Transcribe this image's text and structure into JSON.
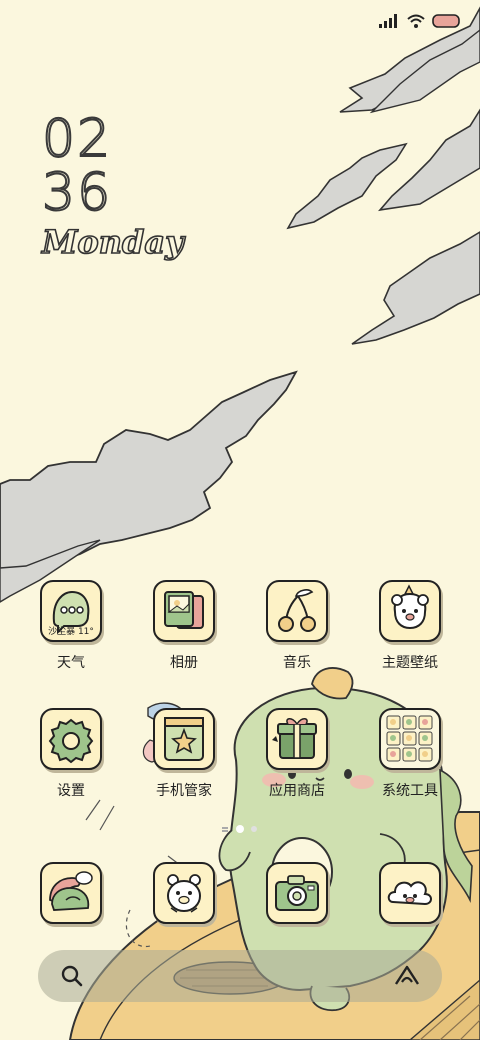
{
  "status_bar": {
    "icons": [
      "signal-icon",
      "wifi-icon",
      "battery-icon"
    ],
    "battery_color": "#e8a49a"
  },
  "clock": {
    "hour": "02",
    "minute": "36",
    "day": "Monday"
  },
  "apps": [
    {
      "name": "天气",
      "icon": "weather-ghost-icon",
      "weather_text": "沙尘暴 11°"
    },
    {
      "name": "相册",
      "icon": "photo-album-icon"
    },
    {
      "name": "音乐",
      "icon": "cherries-music-icon"
    },
    {
      "name": "主题壁纸",
      "icon": "bear-theme-icon"
    },
    {
      "name": "设置",
      "icon": "gear-icon"
    },
    {
      "name": "手机管家",
      "icon": "star-shield-icon"
    },
    {
      "name": "应用商店",
      "icon": "gift-store-icon"
    },
    {
      "name": "系统工具",
      "icon": "tools-folder-icon"
    },
    {
      "name": "",
      "icon": "chat-ball-icon"
    },
    {
      "name": "",
      "icon": "bear-icon"
    },
    {
      "name": "",
      "icon": "camera-icon"
    },
    {
      "name": "",
      "icon": "cloud-icon"
    }
  ],
  "search_bar": {
    "left_icon": "search-icon",
    "right_icon": "assistant-icon"
  },
  "page_indicator": {
    "pages": 3,
    "current": 2
  },
  "colors": {
    "background": "#fbf7de",
    "tile": "#fdf2c6",
    "dino": "#cfe0b0",
    "platform": "#f1cf8a"
  }
}
